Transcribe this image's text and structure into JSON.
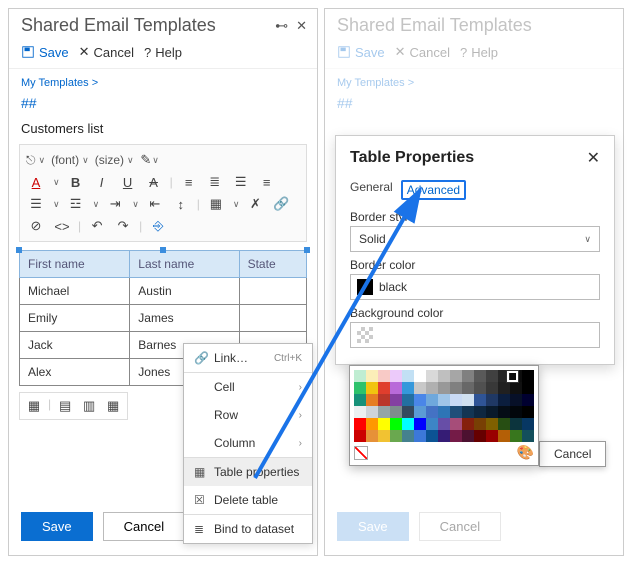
{
  "left": {
    "title": "Shared Email Templates",
    "save": "Save",
    "cancel": "Cancel",
    "help": "Help",
    "breadcrumb": "My Templates >",
    "hash": "##",
    "doc_title": "Customers list",
    "font_label": "(font)",
    "size_label": "(size)",
    "table": {
      "headers": [
        "First name",
        "Last name",
        "State"
      ],
      "rows": [
        [
          "Michael",
          "Austin",
          ""
        ],
        [
          "Emily",
          "James",
          ""
        ],
        [
          "Jack",
          "Barnes",
          ""
        ],
        [
          "Alex",
          "Jones",
          ""
        ]
      ]
    },
    "ctx": {
      "link": "Link…",
      "link_shortcut": "Ctrl+K",
      "cell": "Cell",
      "row": "Row",
      "column": "Column",
      "table_properties": "Table properties",
      "delete_table": "Delete table",
      "bind": "Bind to dataset"
    },
    "bottom_save": "Save",
    "bottom_cancel": "Cancel"
  },
  "right": {
    "title": "Shared Email Templates",
    "save": "Save",
    "cancel": "Cancel",
    "help": "Help",
    "breadcrumb": "My Templates >",
    "hash": "##",
    "dialog": {
      "title": "Table Properties",
      "tab_general": "General",
      "tab_advanced": "Advanced",
      "border_style_label": "Border style",
      "border_style_value": "Solid",
      "border_color_label": "Border color",
      "border_color_value": "black",
      "bg_color_label": "Background color"
    },
    "picker_cancel": "Cancel",
    "bottom_save": "Save",
    "bottom_cancel": "Cancel"
  },
  "palette": [
    [
      "#BFEDD2",
      "#FBEEB8",
      "#F8CAC6",
      "#ECCAFA",
      "#C2E0F4",
      "#ffffff",
      "#d9d9d9",
      "#bfbfbf",
      "#a6a6a6",
      "#808080",
      "#595959",
      "#404040",
      "#262626",
      "#0d0d0d",
      "#000000"
    ],
    [
      "#2DC26B",
      "#F1C40F",
      "#E03E2D",
      "#B96AD9",
      "#3598DB",
      "#c8c8c8",
      "#b0b0b0",
      "#989898",
      "#808080",
      "#686868",
      "#505050",
      "#383838",
      "#202020",
      "#101010",
      "#000000"
    ],
    [
      "#169179",
      "#E67E23",
      "#BA372A",
      "#843FA1",
      "#236FA1",
      "#4a86e8",
      "#6fa8dc",
      "#9fc5e8",
      "#c9daf5",
      "#d0e0f0",
      "#2f5496",
      "#1f3864",
      "#0b1e3e",
      "#071028",
      "#000030"
    ],
    [
      "#ECF0F1",
      "#CED4D9",
      "#95A5A6",
      "#7E8C8D",
      "#34495E",
      "#5b9bd5",
      "#4472c4",
      "#2e75b6",
      "#1f4e79",
      "#133553",
      "#0e2740",
      "#091a2b",
      "#050d16",
      "#02060b",
      "#000000"
    ],
    [
      "#ff0000",
      "#ff9900",
      "#ffff00",
      "#00ff00",
      "#00ffff",
      "#0000ff",
      "#3d85c6",
      "#674ea7",
      "#a64d79",
      "#85200c",
      "#783f04",
      "#7f6000",
      "#274e13",
      "#0c343d",
      "#073763"
    ],
    [
      "#cc0000",
      "#e69138",
      "#f1c232",
      "#6aa84f",
      "#45818e",
      "#3c78d8",
      "#0b5394",
      "#351c75",
      "#741b47",
      "#4c1130",
      "#660000",
      "#990000",
      "#b45f06",
      "#38761d",
      "#134f5c"
    ]
  ]
}
